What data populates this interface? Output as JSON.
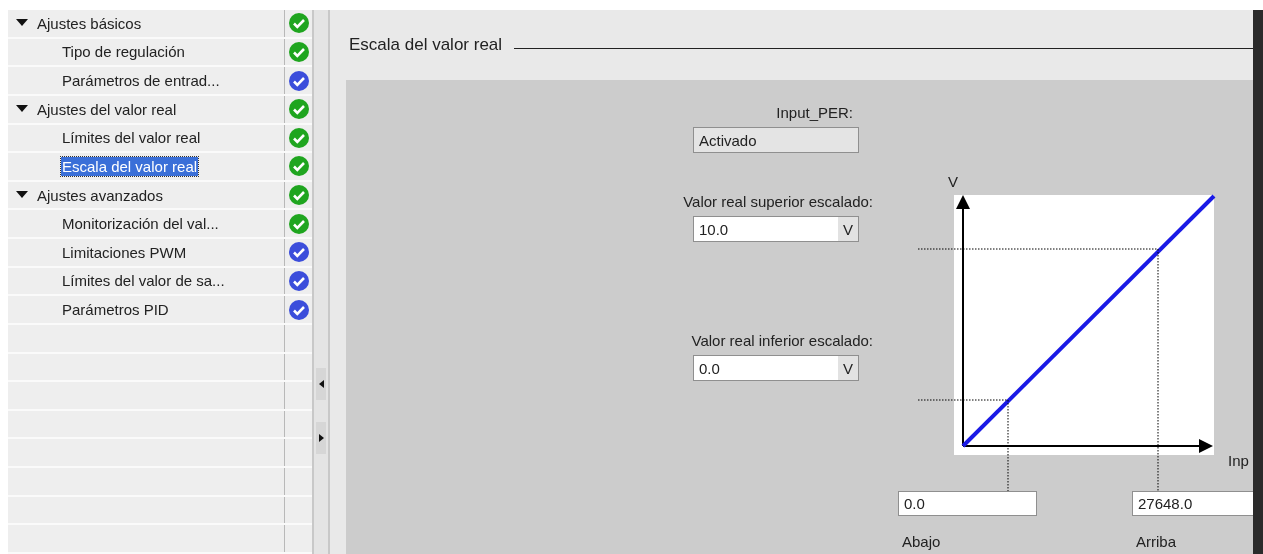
{
  "navigation": {
    "items": [
      {
        "label": "Ajustes básicos",
        "expanded": true,
        "selected": false,
        "color": "#1fa51f",
        "children": [
          {
            "label": "Tipo de regulación",
            "selected": false,
            "color": "#1fa51f"
          },
          {
            "label": "Parámetros de entrad...",
            "selected": false,
            "color": "#3b4ddb"
          }
        ]
      },
      {
        "label": "Ajustes del valor real",
        "expanded": true,
        "selected": false,
        "color": "#1fa51f",
        "children": [
          {
            "label": "Límites del valor real",
            "selected": false,
            "color": "#1fa51f"
          },
          {
            "label": "Escala del valor real",
            "selected": true,
            "color": "#1fa51f"
          }
        ]
      },
      {
        "label": "Ajustes avanzados",
        "expanded": true,
        "selected": false,
        "color": "#1fa51f",
        "children": [
          {
            "label": "Monitorización del val...",
            "selected": false,
            "color": "#1fa51f"
          },
          {
            "label": "Limitaciones PWM",
            "selected": false,
            "color": "#3b4ddb"
          },
          {
            "label": "Límites del valor de sa...",
            "selected": false,
            "color": "#3b4ddb"
          },
          {
            "label": "Parámetros PID",
            "selected": false,
            "color": "#3b4ddb"
          }
        ]
      }
    ]
  },
  "section_title": "Escala del valor real",
  "input_per": {
    "label": "Input_PER:",
    "value": "Activado",
    "disabled": true
  },
  "upper": {
    "label": "Valor real superior escalado:",
    "value": "10.0",
    "unit": "V",
    "disabled": false
  },
  "lower": {
    "label": "Valor real inferior escalado:",
    "value": "0.0",
    "unit": "V",
    "disabled": false
  },
  "graph": {
    "y_axis_label": "V",
    "x_axis_label": "Inp"
  },
  "low_input": {
    "value": "0.0",
    "caption": "Abajo"
  },
  "high_input": {
    "value": "27648.0",
    "caption": "Arriba"
  }
}
